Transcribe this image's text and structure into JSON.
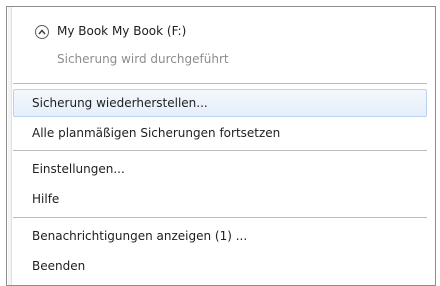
{
  "device": {
    "title": "My Book  My Book (F:)",
    "status": "Sicherung wird durchgeführt",
    "collapse_icon": "chevron-up-icon"
  },
  "menu": {
    "items": [
      {
        "label": "Sicherung wiederherstellen..."
      },
      {
        "label": "Alle planmäßigen Sicherungen fortsetzen"
      },
      {
        "label": "Einstellungen..."
      },
      {
        "label": "Hilfe"
      },
      {
        "label": "Benachrichtigungen anzeigen (1) ..."
      },
      {
        "label": "Beenden"
      }
    ]
  },
  "colors": {
    "highlight": "#e4eefb",
    "highlight_border": "#b8d4f2",
    "status_text": "#8c8c8c"
  }
}
